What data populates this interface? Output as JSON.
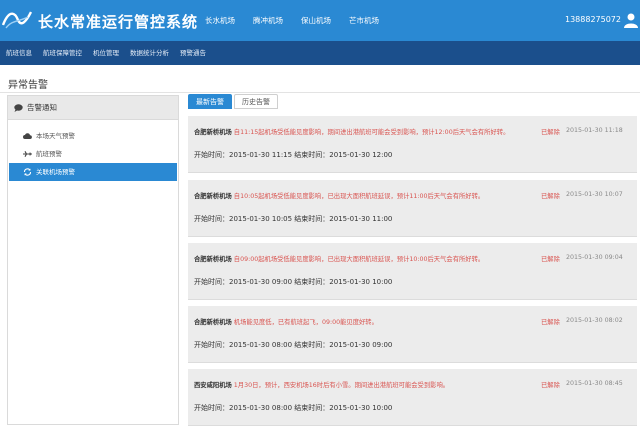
{
  "header": {
    "system_title": "长水常准运行管控系统",
    "airport_tabs": [
      "长水机场",
      "腾冲机场",
      "保山机场",
      "芒市机场"
    ],
    "user_phone": "13888275072"
  },
  "subnav": {
    "items": [
      "航班信息",
      "航班保障管控",
      "机位管理",
      "数据统计分析",
      "预警通告"
    ]
  },
  "page": {
    "title": "异常告警"
  },
  "sidebar": {
    "header": "告警通知",
    "items": [
      {
        "label": "本场天气预警",
        "icon": "cloud-icon"
      },
      {
        "label": "航班预警",
        "icon": "airplane-icon"
      },
      {
        "label": "关联机场预警",
        "icon": "refresh-icon"
      }
    ],
    "active_index": 2
  },
  "tabs": [
    {
      "label": "最新告警",
      "active": true
    },
    {
      "label": "历史告警",
      "active": false
    }
  ],
  "alerts": [
    {
      "airport": "合肥新桥机场",
      "message": "自11:15起机场受低能见度影响，期间进出港航班可能会受到影响，预计12:00后天气会有所好转。",
      "status": "已解除",
      "timestamp": "2015-01-30 11:18",
      "time_range": "开始时间：2015-01-30 11:15 结束时间：2015-01-30 12:00"
    },
    {
      "airport": "合肥新桥机场",
      "message": "自10:05起机场受低能见度影响，已出现大面积航班延误，预计11:00后天气会有所好转。",
      "status": "已解除",
      "timestamp": "2015-01-30 10:07",
      "time_range": "开始时间：2015-01-30 10:05 结束时间：2015-01-30 11:00"
    },
    {
      "airport": "合肥新桥机场",
      "message": "自09:00起机场受低能见度影响，已出现大面积航班延误，预计10:00后天气会有所好转。",
      "status": "已解除",
      "timestamp": "2015-01-30 09:04",
      "time_range": "开始时间：2015-01-30 09:00 结束时间：2015-01-30 10:00"
    },
    {
      "airport": "合肥新桥机场",
      "message": "机场能见度低，已有航班起飞，09:00能见度好转。",
      "status": "已解除",
      "timestamp": "2015-01-30 08:02",
      "time_range": "开始时间：2015-01-30 08:00 结束时间：2015-01-30 09:00"
    },
    {
      "airport": "西安咸阳机场",
      "message": "1月30日，预计，西安机场16时后有小雪。期间进出港航班可能会受到影响。",
      "status": "已解除",
      "timestamp": "2015-01-30 08:45",
      "time_range": "开始时间：2015-01-30 08:00 结束时间：2015-01-30 10:00"
    }
  ],
  "colors": {
    "header_blue": "#2a89d3",
    "subnav_navy": "#1b4f8c",
    "alert_red": "#d9534f"
  }
}
